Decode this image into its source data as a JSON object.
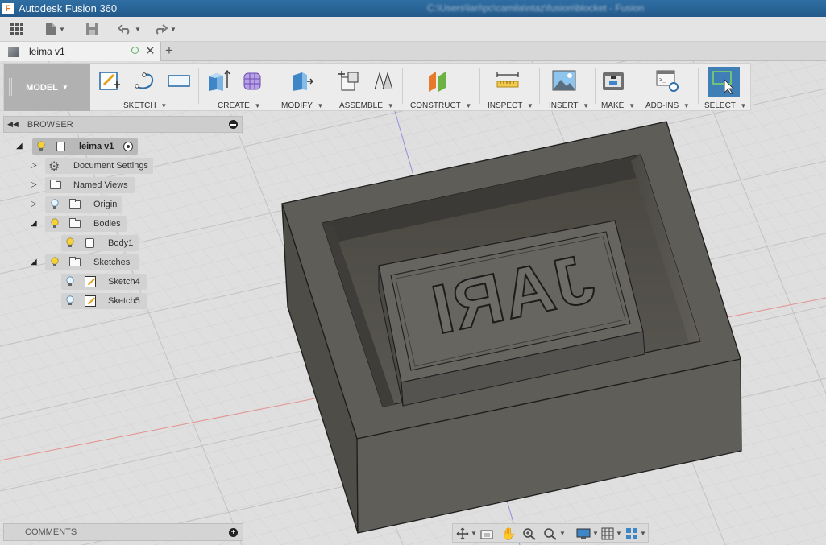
{
  "window": {
    "app_title": "Autodesk Fusion 360",
    "logo_letter": "F",
    "document_path": "C:\\Users\\lari\\pc\\camila\\ntaz\\fusion\\blocket - Fusion"
  },
  "tab": {
    "label": "leima v1"
  },
  "toolbar": {
    "workspace_label": "MODEL",
    "groups": {
      "sketch": "SKETCH",
      "create": "CREATE",
      "modify": "MODIFY",
      "assemble": "ASSEMBLE",
      "construct": "CONSTRUCT",
      "inspect": "INSPECT",
      "insert": "INSERT",
      "make": "MAKE",
      "addins": "ADD-INS",
      "select": "SELECT"
    },
    "icons": [
      "create-sketch-icon",
      "arc-icon",
      "rectangle-icon",
      "extrude-icon",
      "form-icon",
      "press-pull-icon",
      "new-component-icon",
      "joint-icon",
      "offset-plane-icon",
      "measure-icon",
      "insert-image-icon",
      "3d-print-icon",
      "scripts-icon",
      "select-icon"
    ]
  },
  "browser": {
    "title": "BROWSER",
    "root": "leima v1",
    "items": [
      {
        "label": "Document Settings",
        "icon": "gear-icon"
      },
      {
        "label": "Named Views",
        "icon": "folder-icon"
      },
      {
        "label": "Origin",
        "icon": "folder-icon"
      },
      {
        "label": "Bodies",
        "icon": "folder-icon"
      },
      {
        "label": "Body1",
        "icon": "body-icon"
      },
      {
        "label": "Sketches",
        "icon": "folder-icon"
      },
      {
        "label": "Sketch4",
        "icon": "sketch-icon"
      },
      {
        "label": "Sketch5",
        "icon": "sketch-icon"
      }
    ]
  },
  "comments": {
    "label": "COMMENTS"
  },
  "model": {
    "embossed_text": "JARI",
    "render_mirrored": true
  },
  "navbar": {
    "icons": [
      "orbit-icon",
      "look-at-icon",
      "pan-icon",
      "zoom-icon",
      "zoom-window-icon",
      "display-settings-icon",
      "grid-settings-icon",
      "viewports-icon"
    ]
  },
  "colors": {
    "title_bar": "#2b6599",
    "workspace_button": "#b1b1b1",
    "select_accent": "#3f7fb5",
    "model_body": "#5e5c56",
    "grid": "#cbcbcb"
  }
}
